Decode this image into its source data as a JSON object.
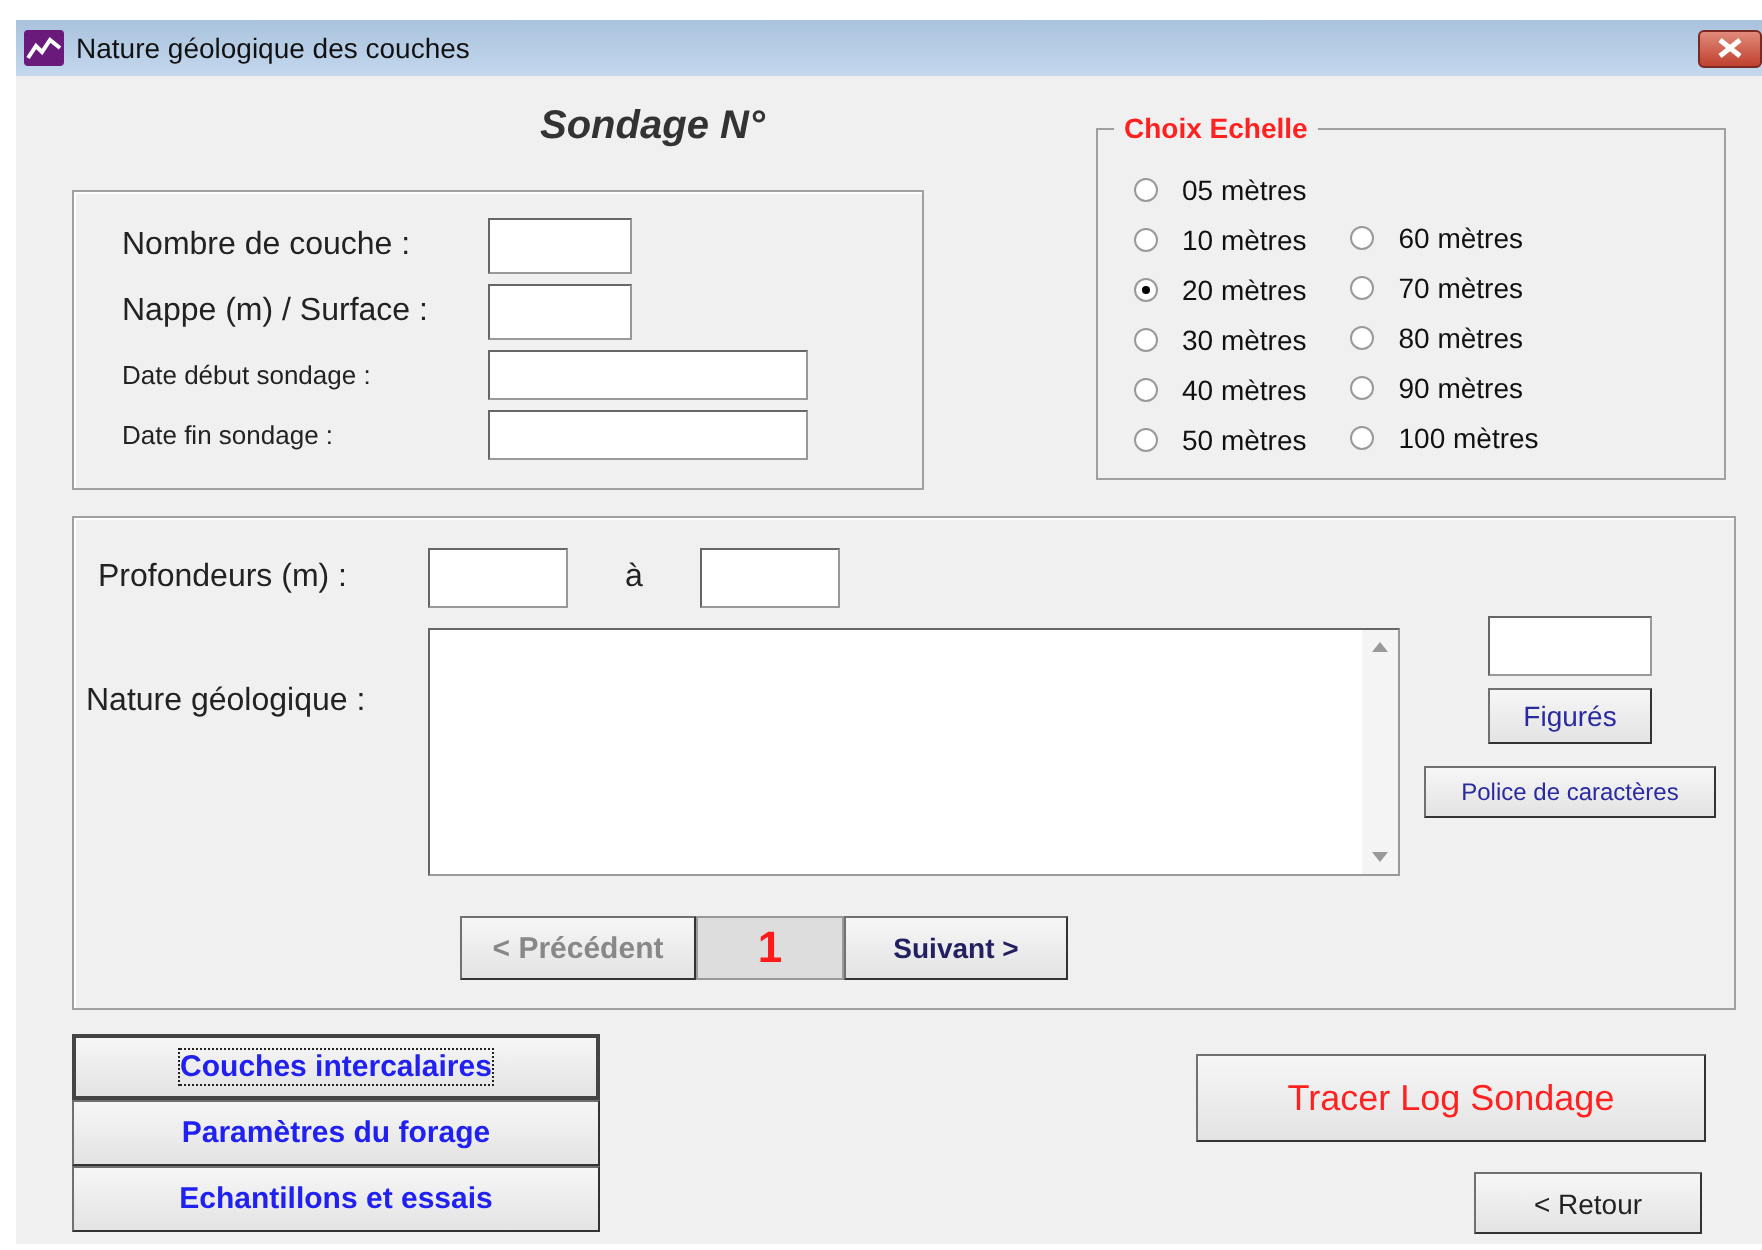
{
  "window": {
    "title": "Nature géologique des couches"
  },
  "heading": "Sondage N°",
  "info_fields": [
    {
      "label": "Nombre de couche  :",
      "kind": "short"
    },
    {
      "label": "Nappe (m) / Surface  :",
      "kind": "short"
    },
    {
      "label": "Date début sondage :",
      "kind": "date"
    },
    {
      "label": "Date fin sondage :",
      "kind": "date"
    }
  ],
  "scale": {
    "title": "Choix Echelle",
    "columns": [
      [
        {
          "label": "05 mètres",
          "selected": false
        },
        {
          "label": "10 mètres",
          "selected": false
        },
        {
          "label": "20 mètres",
          "selected": true
        },
        {
          "label": "30 mètres",
          "selected": false
        },
        {
          "label": "40 mètres",
          "selected": false
        },
        {
          "label": "50 mètres",
          "selected": false
        }
      ],
      [
        {
          "label": "60 mètres",
          "selected": false
        },
        {
          "label": "70 mètres",
          "selected": false
        },
        {
          "label": "80 mètres",
          "selected": false
        },
        {
          "label": "90 mètres",
          "selected": false
        },
        {
          "label": "100 mètres",
          "selected": false
        }
      ]
    ]
  },
  "depth": {
    "label": "Profondeurs (m) :",
    "connector": "à"
  },
  "nature": {
    "label": "Nature géologique :"
  },
  "pattern_button": "Figurés",
  "font_button": "Police de caractères",
  "nav": {
    "previous": "< Précédent",
    "page": "1",
    "next": "Suivant >"
  },
  "side_buttons": [
    {
      "label": "Couches intercalaires",
      "focused": true
    },
    {
      "label": "Paramètres du forage",
      "focused": false
    },
    {
      "label": "Echantillons et essais",
      "focused": false
    }
  ],
  "plot_button": "Tracer Log Sondage",
  "back_button": "<  Retour"
}
